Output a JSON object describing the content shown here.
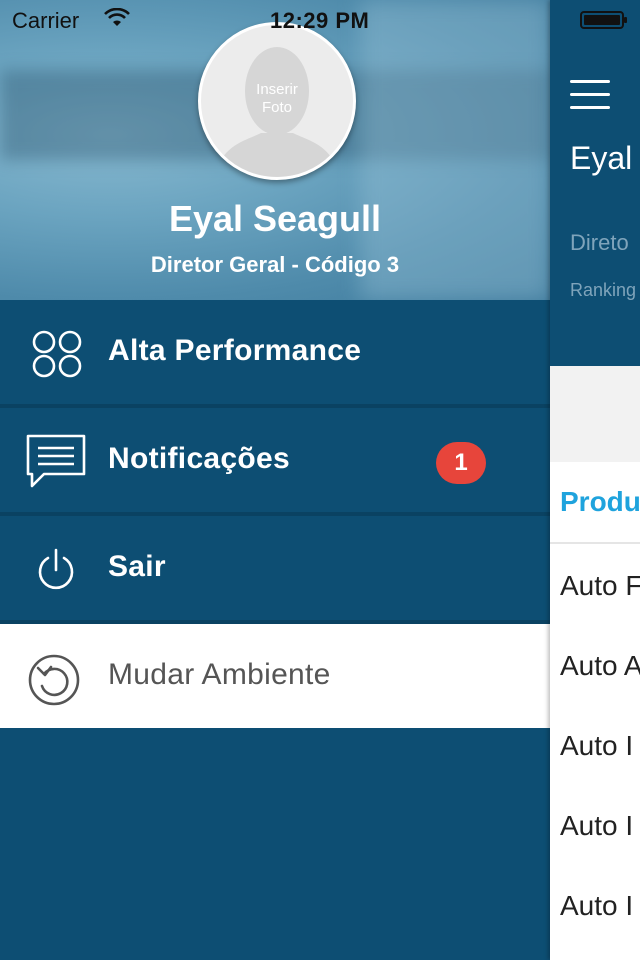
{
  "status_bar": {
    "carrier": "Carrier",
    "time": "12:29 PM"
  },
  "profile": {
    "avatar_placeholder_line1": "Inserir",
    "avatar_placeholder_line2": "Foto",
    "name": "Eyal Seagull",
    "role": "Diretor Geral - Código 3"
  },
  "menu": {
    "items": [
      {
        "label": "Alta Performance",
        "icon": "four-circles-icon"
      },
      {
        "label": "Notificações",
        "icon": "chat-bubble-icon",
        "badge": "1"
      },
      {
        "label": "Sair",
        "icon": "power-icon"
      },
      {
        "label": "Mudar Ambiente",
        "icon": "refresh-icon",
        "active": true
      }
    ]
  },
  "main": {
    "name_partial": "Eyal",
    "role_partial": "Direto",
    "ranking_partial": "Ranking",
    "section_title_partial": "Produ",
    "rows": [
      "Auto F",
      "Auto A",
      "Auto I",
      "Auto I",
      "Auto I"
    ]
  },
  "colors": {
    "primary": "#0d4e73",
    "accent": "#1fa3dd",
    "badge": "#e7453b"
  }
}
